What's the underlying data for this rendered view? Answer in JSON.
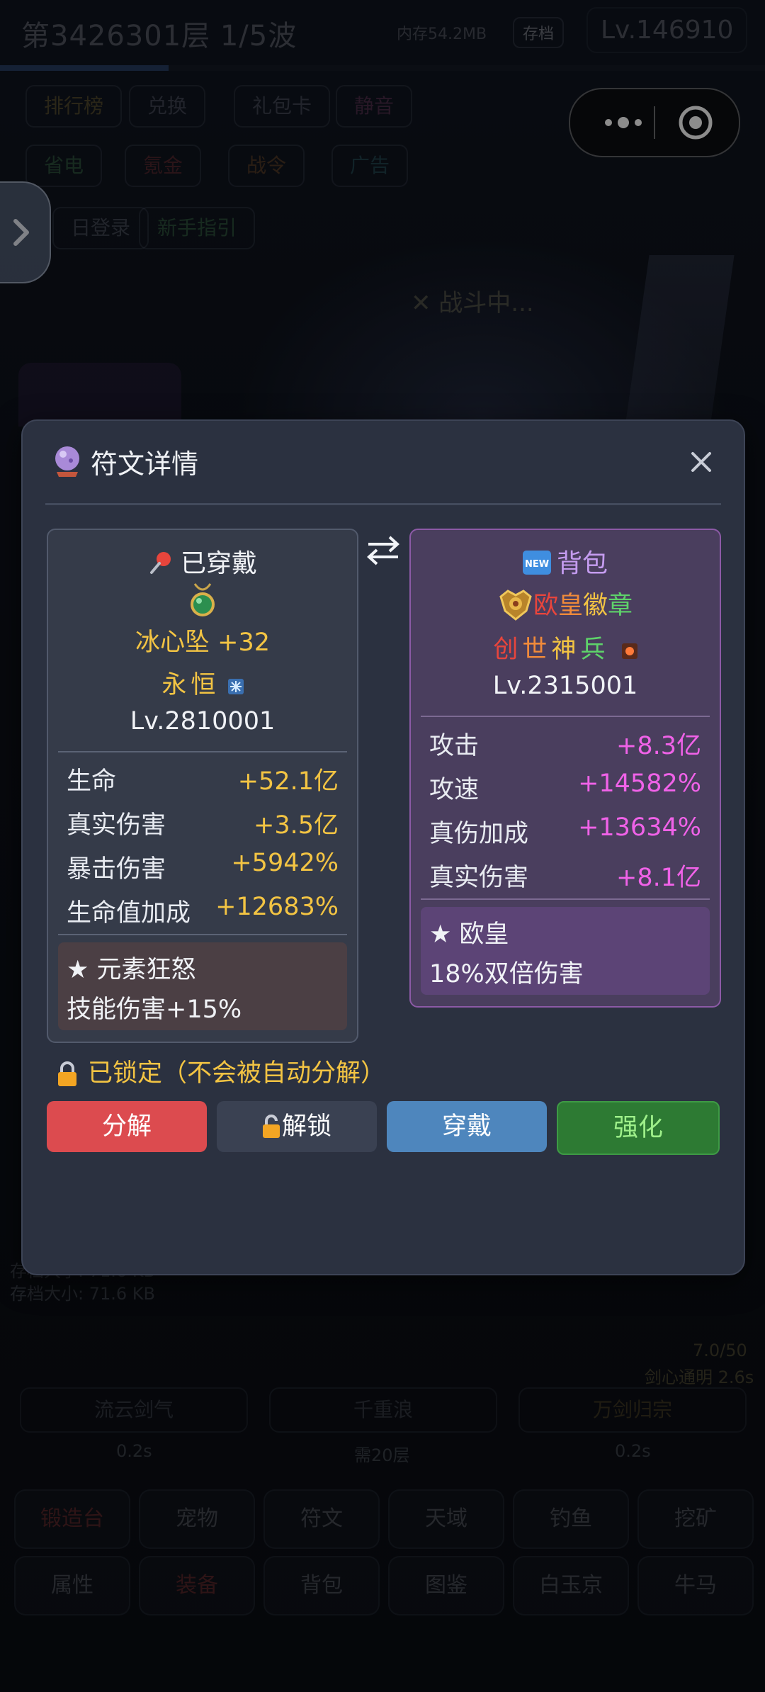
{
  "background": {
    "level_title": "第3426301层  1/5波",
    "memory": "内存54.2MB",
    "save_badge": "存档",
    "level_badge": "Lv.146910",
    "progress_fraction": 0.22,
    "chips_row1": [
      "排行榜",
      "兑换",
      "礼包卡",
      "静音"
    ],
    "chips_row2": [
      "省电",
      "氪金",
      "战令",
      "广告"
    ],
    "chips_row3": [
      "日登录",
      "新手指引"
    ],
    "battle_status": "战斗中...",
    "save_size_1": "存档大小: 71.6 KB",
    "save_size_2": "存档大小: 71.6 KB",
    "buff_count": "7.0/50",
    "buff_name": "剑心通明 2.6s",
    "skill_buttons": [
      "流云剑气",
      "千重浪",
      "万剑归宗"
    ],
    "skill_times": [
      "0.2s",
      "需20层",
      "0.2s"
    ],
    "nav_row1": [
      "锻造台",
      "宠物",
      "符文",
      "天域",
      "钓鱼",
      "挖矿"
    ],
    "nav_row2": [
      "属性",
      "装备",
      "背包",
      "图鉴",
      "白玉京",
      "牛马"
    ]
  },
  "modal": {
    "title": "符文详情",
    "left": {
      "header": "已穿戴",
      "name": "冰心坠 +32",
      "quality": "永恒",
      "level": "Lv.2810001",
      "stats": [
        {
          "label": "生命",
          "value": "+52.1亿"
        },
        {
          "label": "真实伤害",
          "value": "+3.5亿"
        },
        {
          "label": "暴击伤害",
          "value": "+5942%"
        },
        {
          "label": "生命值加成",
          "value": "+12683%"
        }
      ],
      "effect_title": "★ 元素狂怒",
      "effect_desc": "技能伤害+15%"
    },
    "right": {
      "header": "背包",
      "name_chars": [
        "欧",
        "皇",
        "徽",
        "章"
      ],
      "quality_chars": [
        "创",
        "世",
        "神",
        "兵"
      ],
      "level": "Lv.2315001",
      "stats": [
        {
          "label": "攻击",
          "value": "+8.3亿"
        },
        {
          "label": "攻速",
          "value": "+14582%"
        },
        {
          "label": "真伤加成",
          "value": "+13634%"
        },
        {
          "label": "真实伤害",
          "value": "+8.1亿"
        }
      ],
      "effect_title": "★ 欧皇",
      "effect_desc": "18%双倍伤害"
    },
    "lock_status": "已锁定（不会被自动分解）",
    "buttons": {
      "decompose": "分解",
      "unlock": "解锁",
      "equip": "穿戴",
      "upgrade": "强化"
    }
  },
  "colors": {
    "gold": "#f3c443",
    "pink": "#f062e8",
    "red": "#dc4b4f",
    "blue": "#4e86bd",
    "green": "#2d7a33"
  }
}
